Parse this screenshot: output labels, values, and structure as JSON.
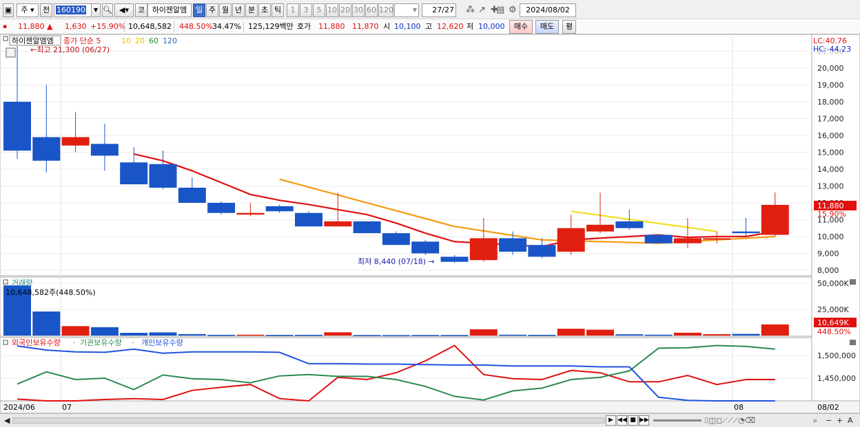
{
  "toolbar": {
    "market_select": "주",
    "prev_label": "전",
    "code": "160190",
    "search_icon": "search-icon",
    "sound_icon": "speaker-icon",
    "kospi_label": "코",
    "stock_name": "하이젠알엠",
    "periods": [
      "일",
      "주",
      "월",
      "년",
      "분",
      "초",
      "틱"
    ],
    "active_period": "일",
    "intervals": [
      "1",
      "3",
      "5",
      "10",
      "20",
      "30",
      "60",
      "120"
    ],
    "counter": "27",
    "counter_total": "/27",
    "date": "2024/08/02"
  },
  "quote": {
    "price": "11,880",
    "change": "1,630",
    "change_pct": "+15.90%",
    "volume": "10,648,582",
    "volume_ratio": "448.50%",
    "turnover": "34.47%",
    "amount": "125,129백만",
    "hoga_label": "호가",
    "ask": "11,880",
    "bid": "11,870",
    "open_label": "시",
    "open": "10,100",
    "high_label": "고",
    "high": "12,620",
    "low_label": "저",
    "low": "10,000",
    "buy_button": "매수",
    "sell_button": "매도",
    "avg_button": "평"
  },
  "price_panel": {
    "title": "하이젠알엠엠",
    "legend_close": "종가 단순",
    "ma_labels": [
      "5",
      "10",
      "20",
      "60",
      "120"
    ],
    "ma_colors": [
      "#e01010",
      "#f0c000",
      "#f0c000",
      "#2a8a2a",
      "#2070c0"
    ],
    "high_note": "최고 21,300 (06/27)",
    "low_note": "최저 8,440 (07/18)",
    "lc": "LC:40.76",
    "hc": "HC:-44.23",
    "y_labels": [
      "21,000",
      "20,000",
      "19,000",
      "18,000",
      "17,000",
      "16,000",
      "15,000",
      "14,000",
      "13,000",
      "12,000",
      "11,000",
      "10,000",
      "9,000",
      "8,000"
    ],
    "last_price_tag": "11,880",
    "last_pct_tag": "15.90%"
  },
  "volume_panel": {
    "title": "거래량",
    "info": "10,648,582주(448.50%)",
    "y_labels": [
      "50,000K",
      "25,000K"
    ],
    "last_tag": "10,649K",
    "last_pct": "448.50%"
  },
  "holdings_panel": {
    "legend": [
      "외국인보유수량",
      "기관보유수량",
      "개인보유수량"
    ],
    "colors": [
      "#e01010",
      "#2a8a50",
      "#2050e0"
    ],
    "y_labels": [
      "1,500,000",
      "1,450,000"
    ]
  },
  "x_axis": {
    "labels": [
      "2024/06",
      "07",
      "08"
    ],
    "right_label": "08/02"
  },
  "chart_data": {
    "type": "candlestick",
    "candles": [
      {
        "o": 18000,
        "h": 21300,
        "l": 14600,
        "c": 15100
      },
      {
        "o": 15900,
        "h": 19000,
        "l": 13800,
        "c": 14500
      },
      {
        "o": 15400,
        "h": 17400,
        "l": 15000,
        "c": 15900
      },
      {
        "o": 15500,
        "h": 16700,
        "l": 13900,
        "c": 14800
      },
      {
        "o": 14400,
        "h": 15300,
        "l": 13100,
        "c": 13100
      },
      {
        "o": 14300,
        "h": 15100,
        "l": 12800,
        "c": 12900
      },
      {
        "o": 12900,
        "h": 13500,
        "l": 12000,
        "c": 12000
      },
      {
        "o": 12000,
        "h": 12100,
        "l": 11300,
        "c": 11400
      },
      {
        "o": 11300,
        "h": 12000,
        "l": 11200,
        "c": 11400
      },
      {
        "o": 11800,
        "h": 11900,
        "l": 11400,
        "c": 11500
      },
      {
        "o": 11400,
        "h": 11500,
        "l": 10600,
        "c": 10600
      },
      {
        "o": 10600,
        "h": 12600,
        "l": 10600,
        "c": 10900
      },
      {
        "o": 10900,
        "h": 10900,
        "l": 10200,
        "c": 10200
      },
      {
        "o": 10200,
        "h": 10300,
        "l": 9500,
        "c": 9500
      },
      {
        "o": 9700,
        "h": 9800,
        "l": 8900,
        "c": 9000
      },
      {
        "o": 8800,
        "h": 8900,
        "l": 8440,
        "c": 8500
      },
      {
        "o": 8600,
        "h": 11100,
        "l": 8500,
        "c": 9900
      },
      {
        "o": 9900,
        "h": 10300,
        "l": 8900,
        "c": 9100
      },
      {
        "o": 9500,
        "h": 9900,
        "l": 8700,
        "c": 8800
      },
      {
        "o": 9100,
        "h": 11300,
        "l": 8900,
        "c": 10500
      },
      {
        "o": 10300,
        "h": 12600,
        "l": 10200,
        "c": 10700
      },
      {
        "o": 10900,
        "h": 11600,
        "l": 10400,
        "c": 10500
      },
      {
        "o": 10100,
        "h": 10100,
        "l": 9600,
        "c": 9600
      },
      {
        "o": 9600,
        "h": 11100,
        "l": 9300,
        "c": 9900
      },
      {
        "o": 9900,
        "h": 10300,
        "l": 9600,
        "c": 9900
      },
      {
        "o": 10300,
        "h": 11100,
        "l": 10000,
        "c": 10200
      },
      {
        "o": 10100,
        "h": 12620,
        "l": 10000,
        "c": 11880
      }
    ],
    "ma5": [
      null,
      null,
      null,
      null,
      14900,
      14500,
      13900,
      13200,
      12500,
      12150,
      11900,
      11600,
      11300,
      10800,
      10200,
      9700,
      9600,
      9500,
      9400,
      9800,
      9900,
      10000,
      10100,
      9950,
      10000,
      10000,
      10300
    ],
    "ma20": [
      null,
      null,
      null,
      null,
      null,
      null,
      null,
      null,
      null,
      13400,
      null,
      null,
      null,
      null,
      null,
      10600,
      null,
      null,
      9800,
      null,
      null,
      null,
      9600,
      null,
      null,
      null,
      10000
    ],
    "ma60": [
      null,
      null,
      null,
      null,
      null,
      null,
      null,
      null,
      null,
      null,
      null,
      null,
      null,
      null,
      null,
      null,
      null,
      null,
      null,
      11500,
      null,
      null,
      null,
      null,
      10300,
      null,
      null
    ],
    "volume_k": [
      48000,
      23000,
      9000,
      8000,
      2600,
      3000,
      1400,
      700,
      800,
      600,
      700,
      3100,
      500,
      400,
      500,
      500,
      6000,
      800,
      700,
      6500,
      5600,
      1200,
      800,
      2700,
      1300,
      1600,
      10649
    ],
    "holdings": {
      "foreign": [
        1404000,
        1400000,
        1400000,
        1403000,
        1405000,
        1403000,
        1423000,
        1430000,
        1436000,
        1405000,
        1400000,
        1452000,
        1447000,
        1462000,
        1488000,
        1522000,
        1458000,
        1449000,
        1447000,
        1467000,
        1462000,
        1442000,
        1442000,
        1456000,
        1436000,
        1447000,
        1447000
      ],
      "institution": [
        1437000,
        1464000,
        1447000,
        1450000,
        1425000,
        1457000,
        1449000,
        1447000,
        1440000,
        1455000,
        1458000,
        1454000,
        1454000,
        1447000,
        1432000,
        1410000,
        1402000,
        1422000,
        1428000,
        1447000,
        1452000,
        1466000,
        1516000,
        1517000,
        1522000,
        1520000,
        1514000
      ],
      "individual": [
        1521000,
        1512000,
        1508000,
        1507000,
        1514000,
        1505000,
        1508000,
        1508000,
        1508000,
        1507000,
        1482000,
        1482000,
        1481000,
        1481000,
        1480000,
        1479000,
        1479000,
        1477000,
        1477000,
        1477000,
        1475000,
        1475000,
        1408000,
        1401000,
        1400000,
        1400000,
        1400000
      ]
    }
  }
}
